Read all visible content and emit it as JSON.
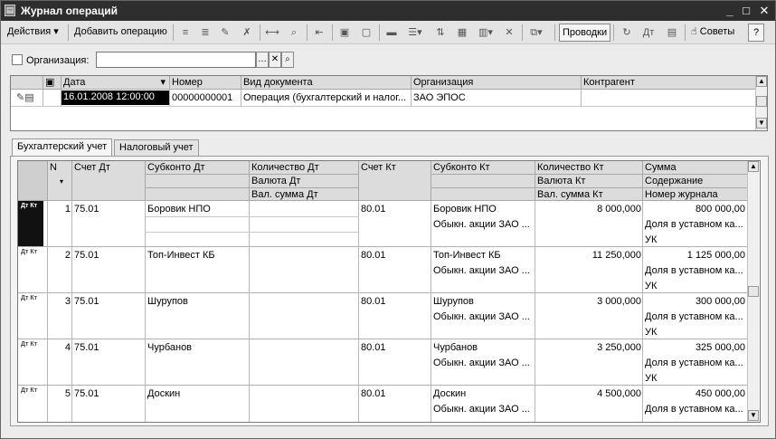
{
  "window": {
    "title": "Журнал операций"
  },
  "toolbar": {
    "actions_label": "Действия",
    "add_label": "Добавить операцию",
    "entries_label": "Проводки",
    "advice_label": "Советы",
    "help_label": "?"
  },
  "filter": {
    "org_label": "Организация:",
    "org_value": ""
  },
  "journal": {
    "columns": [
      "Дата",
      "Номер",
      "Вид документа",
      "Организация",
      "Контрагент"
    ],
    "rows": [
      {
        "date": "16.01.2008 12:00:00",
        "number": "00000000001",
        "doc_type": "Операция (бухгалтерский и налог...",
        "org": "ЗАО ЭПОС",
        "counterparty": ""
      }
    ]
  },
  "tabs": [
    "Бухгалтерский учет",
    "Налоговый учет"
  ],
  "entries": {
    "headers": {
      "n": "N",
      "acc_dt": "Счет Дт",
      "sub_dt": "Субконто Дт",
      "qty_dt": "Количество Дт",
      "cur_dt": "Валюта Дт",
      "cursum_dt": "Вал. сумма Дт",
      "acc_kt": "Счет Кт",
      "sub_kt": "Субконто Кт",
      "qty_kt": "Количество Кт",
      "cur_kt": "Валюта Кт",
      "cursum_kt": "Вал. сумма Кт",
      "sum": "Сумма",
      "content": "Содержание",
      "journal_no": "Номер журнала"
    },
    "icon_text": "Дт Кт",
    "rows": [
      {
        "n": "1",
        "acc_dt": "75.01",
        "sub_dt": "Боровик НПО",
        "acc_kt": "80.01",
        "sub_kt1": "Боровик НПО",
        "sub_kt2": "Обыкн. акции ЗАО ...",
        "qty_kt": "8 000,000",
        "sum": "800 000,00",
        "content": "Доля в уставном ка...",
        "journal": "УК"
      },
      {
        "n": "2",
        "acc_dt": "75.01",
        "sub_dt": "Топ-Инвест КБ",
        "acc_kt": "80.01",
        "sub_kt1": "Топ-Инвест КБ",
        "sub_kt2": "Обыкн. акции ЗАО ...",
        "qty_kt": "11 250,000",
        "sum": "1 125 000,00",
        "content": "Доля в уставном ка...",
        "journal": "УК"
      },
      {
        "n": "3",
        "acc_dt": "75.01",
        "sub_dt": "Шурупов",
        "acc_kt": "80.01",
        "sub_kt1": "Шурупов",
        "sub_kt2": "Обыкн. акции ЗАО ...",
        "qty_kt": "3 000,000",
        "sum": "300 000,00",
        "content": "Доля в уставном ка...",
        "journal": "УК"
      },
      {
        "n": "4",
        "acc_dt": "75.01",
        "sub_dt": "Чурбанов",
        "acc_kt": "80.01",
        "sub_kt1": "Чурбанов",
        "sub_kt2": "Обыкн. акции ЗАО ...",
        "qty_kt": "3 250,000",
        "sum": "325 000,00",
        "content": "Доля в уставном ка...",
        "journal": "УК"
      },
      {
        "n": "5",
        "acc_dt": "75.01",
        "sub_dt": "Доскин",
        "acc_kt": "80.01",
        "sub_kt1": "Доскин",
        "sub_kt2": "Обыкн. акции ЗАО ...",
        "qty_kt": "4 500,000",
        "sum": "450 000,00",
        "content": "Доля в уставном ка...",
        "journal": ""
      }
    ]
  }
}
